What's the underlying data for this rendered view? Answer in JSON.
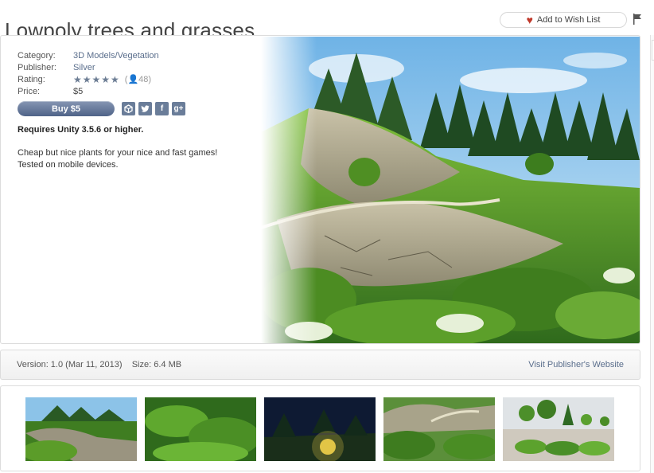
{
  "page": {
    "title": "Lowpoly trees and grasses"
  },
  "wishlist": {
    "label": "Add to Wish List"
  },
  "details": {
    "category_label": "Category:",
    "category_value": "3D Models/Vegetation",
    "publisher_label": "Publisher:",
    "publisher_value": "Silver",
    "rating_label": "Rating:",
    "rating_stars": "★★★★★",
    "rating_count": "48",
    "price_label": "Price:",
    "price_value": "$5"
  },
  "buy_button": {
    "label": "Buy $5"
  },
  "share_icons": [
    "unity-icon",
    "twitter-icon",
    "facebook-icon",
    "google-plus-icon"
  ],
  "requirement": "Requires Unity 3.5.6 or higher.",
  "description": "Cheap but nice plants for your nice and fast games! Tested on mobile devices.",
  "version_bar": {
    "version": "Version: 1.0 (Mar 11, 2013)",
    "size": "Size: 6.4 MB",
    "visit": "Visit Publisher's Website"
  },
  "colors": {
    "accent": "#5a6e8c",
    "button": "#5b6f92",
    "heart": "#c0392b"
  }
}
